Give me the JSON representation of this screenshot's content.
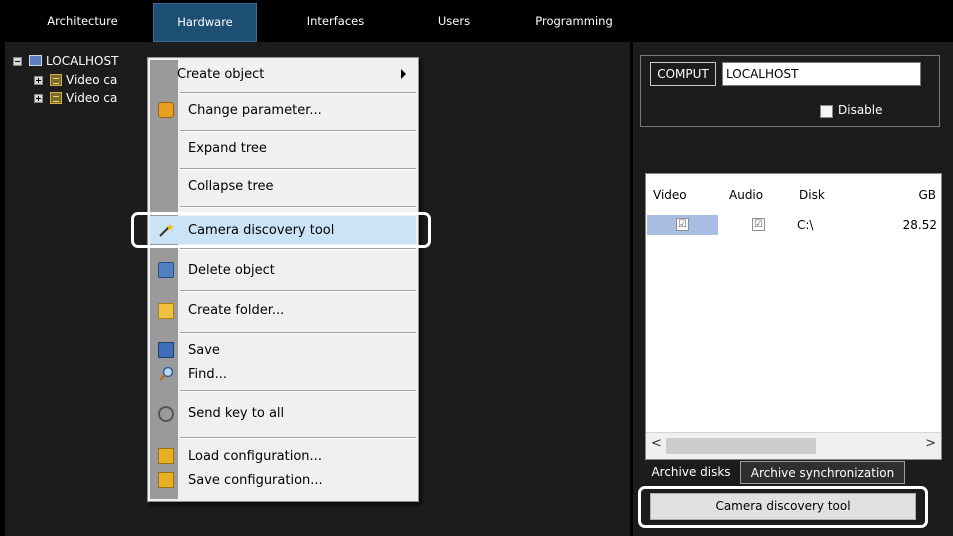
{
  "top_tabs": [
    {
      "label": "Architecture"
    },
    {
      "label": "Hardware"
    },
    {
      "label": "Interfaces"
    },
    {
      "label": "Users"
    },
    {
      "label": "Programming"
    }
  ],
  "tree": {
    "root_label": "LOCALHOST",
    "children": [
      {
        "label": "Video ca"
      },
      {
        "label": "Video ca"
      }
    ]
  },
  "context_menu": {
    "items": [
      {
        "label": "Create object"
      },
      {
        "label": "Change parameter..."
      },
      {
        "label": "Expand tree"
      },
      {
        "label": "Collapse tree"
      },
      {
        "label": "Camera discovery tool"
      },
      {
        "label": "Delete object"
      },
      {
        "label": "Create folder..."
      },
      {
        "label": "Save"
      },
      {
        "label": "Find..."
      },
      {
        "label": "Send key to all"
      },
      {
        "label": "Load configuration..."
      },
      {
        "label": "Save configuration..."
      }
    ]
  },
  "object_settings": {
    "type_label": "COMPUT",
    "name_value": "LOCALHOST",
    "disable_label": "Disable"
  },
  "archive_grid": {
    "columns": [
      "Video",
      "Audio",
      "Disk",
      "GB"
    ],
    "rows": [
      {
        "video": "☑",
        "audio": "☑",
        "disk": "C:\\",
        "gb": "28.52"
      }
    ]
  },
  "bottom_tabs": [
    {
      "label": "Archive disks"
    },
    {
      "label": "Archive synchronization"
    }
  ],
  "discovery_button": {
    "label": "Camera discovery tool"
  },
  "colors": {
    "active_tab": "#1d4e74",
    "menu_highlight": "#cbe3f7",
    "selected_cell": "#a8bfe3"
  }
}
